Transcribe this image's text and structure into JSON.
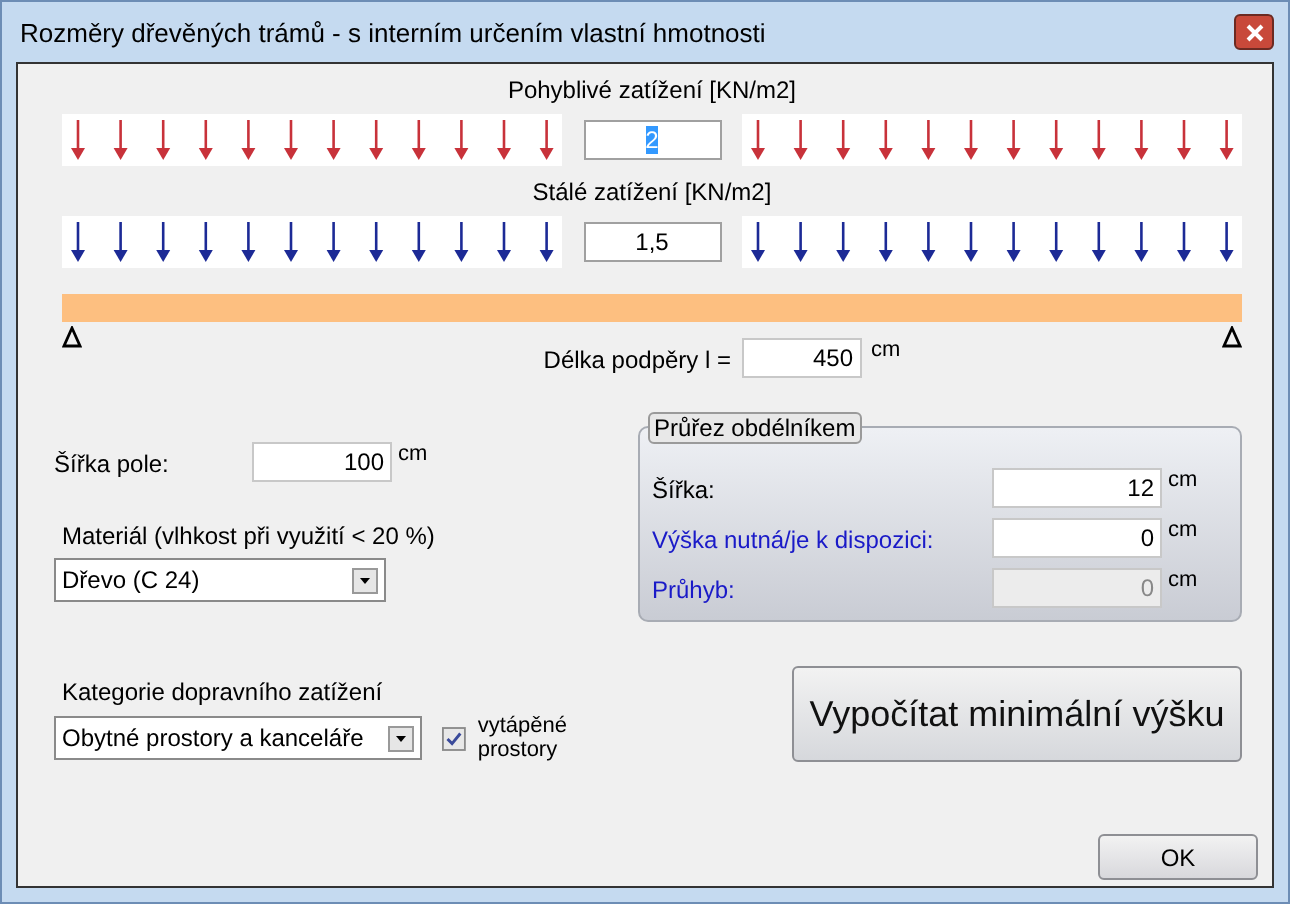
{
  "window": {
    "title": "Rozměry dřevěných trámů - s interním určením vlastní hmotnosti"
  },
  "loads": [
    {
      "kind": "live",
      "label": "Pohyblivé zatížení [KN/m2]",
      "value": "2",
      "selected": true
    },
    {
      "kind": "dead",
      "label": "Stálé zatížení [KN/m2]",
      "value": "1,5",
      "selected": false
    }
  ],
  "span": {
    "label": "Délka podpěry l =",
    "value": "450",
    "unit": "cm"
  },
  "field_width": {
    "label": "Šířka pole:",
    "value": "100",
    "unit": "cm"
  },
  "material": {
    "label": "Materiál (vlhkost při využití < 20 %)",
    "value": "Dřevo (C 24)"
  },
  "category": {
    "label": "Kategorie dopravního zatížení",
    "value": "Obytné prostory a kanceláře"
  },
  "heated": {
    "label": "vytápěné prostory",
    "checked": true
  },
  "section": {
    "title": "Průřez obdélníkem",
    "rows": [
      {
        "label": "Šířka:",
        "value": "12",
        "unit": "cm",
        "highlight": false,
        "disabled": false
      },
      {
        "label": "Výška nutná/je k dispozici:",
        "value": "0",
        "unit": "cm",
        "highlight": true,
        "disabled": false
      },
      {
        "label": "Průhyb:",
        "value": "0",
        "unit": "cm",
        "highlight": true,
        "disabled": true
      }
    ]
  },
  "calculate_button": "Vypočítat minimální výšku",
  "ok_button": "OK"
}
